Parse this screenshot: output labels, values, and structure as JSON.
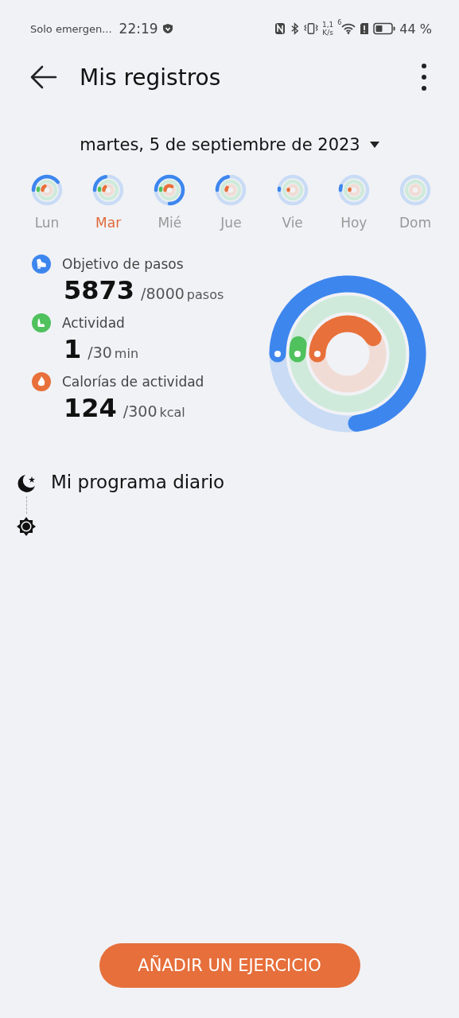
{
  "status_bar": {
    "carrier": "Solo emergen...",
    "time": "22:19",
    "speed_value": "1,1",
    "speed_unit": "K/s",
    "wifi_label": "6",
    "battery_text": "44 %"
  },
  "header": {
    "title": "Mis registros"
  },
  "date_picker": {
    "label": "martes, 5 de septiembre de 2023"
  },
  "days": [
    {
      "label": "Lun",
      "selected": false
    },
    {
      "label": "Mar",
      "selected": true
    },
    {
      "label": "Mié",
      "selected": false
    },
    {
      "label": "Jue",
      "selected": false
    },
    {
      "label": "Vie",
      "selected": false
    },
    {
      "label": "Hoy",
      "selected": false
    },
    {
      "label": "Dom",
      "selected": false
    }
  ],
  "metrics": [
    {
      "kind": "steps",
      "label": "Objetivo de pasos",
      "value": "5873",
      "goal": "/8000",
      "unit": "pasos"
    },
    {
      "kind": "activity",
      "label": "Actividad",
      "value": "1",
      "goal": "/30",
      "unit": "min"
    },
    {
      "kind": "calories",
      "label": "Calorías de actividad",
      "value": "124",
      "goal": "/300",
      "unit": "kcal"
    }
  ],
  "program": {
    "title": "Mi programa diario"
  },
  "add_button": {
    "label": "AÑADIR UN EJERCICIO"
  }
}
